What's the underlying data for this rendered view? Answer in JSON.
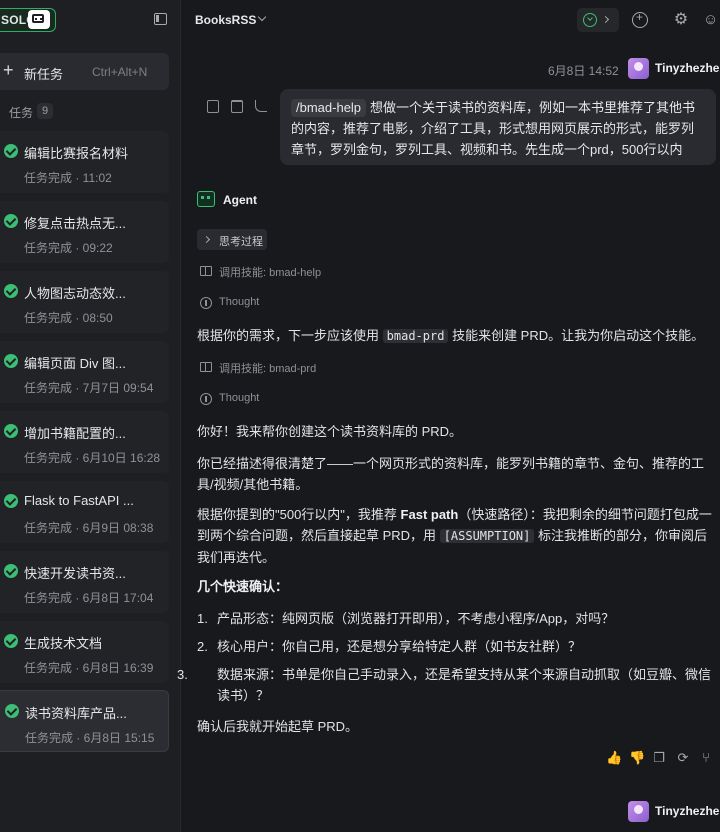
{
  "sidebar": {
    "brand": "SOLO",
    "new_task_label": "新任务",
    "new_task_shortcut": "Ctrl+Alt+N",
    "tasks_header": "任务",
    "tasks_count": "9",
    "tasks": [
      {
        "title": "编辑比赛报名材料",
        "meta": "任务完成 · 11:02"
      },
      {
        "title": "修复点击热点无...",
        "meta": "任务完成 · 09:22"
      },
      {
        "title": "人物图志动态效...",
        "meta": "任务完成 · 08:50"
      },
      {
        "title": "编辑页面 Div 图...",
        "meta": "任务完成 · 7月7日 09:54"
      },
      {
        "title": "增加书籍配置的...",
        "meta": "任务完成 · 6月10日 16:28"
      },
      {
        "title": "Flask to FastAPI ...",
        "meta": "任务完成 · 6月9日 08:38"
      },
      {
        "title": "快速开发读书资...",
        "meta": "任务完成 · 6月8日 17:04"
      },
      {
        "title": "生成技术文档",
        "meta": "任务完成 · 6月8日 16:39"
      },
      {
        "title": "读书资料库产品...",
        "meta": "任务完成 · 6月8日 15:15"
      }
    ]
  },
  "topbar": {
    "repo_name": "BooksRSS"
  },
  "chat": {
    "user_message": {
      "time": "6月8日 14:52",
      "user": "Tinyzhezhe",
      "command": "/bmad-help",
      "text": "想做一个关于读书的资料库，例如一本书里推荐了其他书的内容，推荐了电影，介绍了工具，形式想用网页展示的形式，能罗列章节，罗列金句，罗列工具、视频和书。先生成一个prd，500行以内"
    },
    "agent": {
      "name": "Agent",
      "thinking_label": "思考过程",
      "step1": "调用技能: bmad-help",
      "thought1": "Thought",
      "p1_a": "根据你的需求，下一步应该使用",
      "p1_code": "bmad-prd",
      "p1_b": "技能来创建 PRD。让我为你启动这个技能。",
      "step2": "调用技能: bmad-prd",
      "thought2": "Thought",
      "p2": "你好！我来帮你创建这个读书资料库的 PRD。",
      "p3": "你已经描述得很清楚了——一个网页形式的资料库，能罗列书籍的章节、金句、推荐的工具/视频/其他书籍。",
      "p4_a": "根据你提到的\"500行以内\"，我推荐",
      "p4_bold": "Fast path",
      "p4_b": "（快速路径）：我把剩余的细节问题打包成一到两个综合问题，然后直接起草 PRD，用",
      "p4_code": "[ASSUMPTION]",
      "p4_c": "标注我推断的部分，你审阅后我们再迭代。",
      "confirm_header": "几个快速确认：",
      "q1": "产品形态：纯网页版（浏览器打开即用），不考虑小程序/App，对吗？",
      "q2": "核心用户：你自己用，还是想分享给特定人群（如书友社群）？",
      "q3": "数据来源：书单是你自己手动录入，还是希望支持从某个来源自动抓取（如豆瓣、微信读书）？",
      "closing": "确认后我就开始起草 PRD。"
    },
    "next_user": "Tinyzhezhe"
  },
  "colors": {
    "accent_green": "#3cbf74",
    "background": "#18191d",
    "sidebar": "#1e1f23"
  }
}
